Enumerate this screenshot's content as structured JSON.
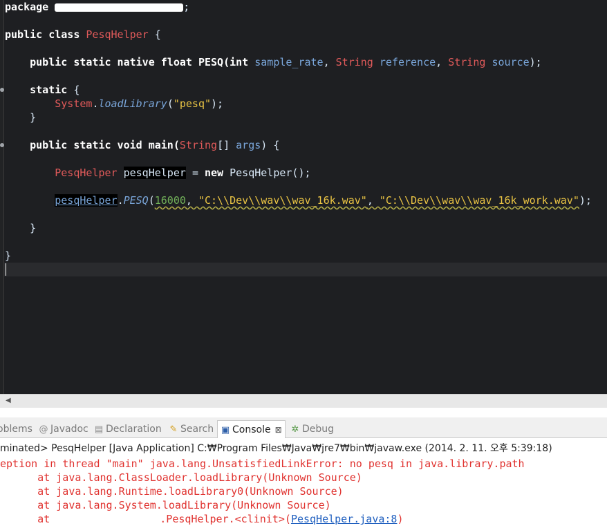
{
  "editor": {
    "package_keyword": "package",
    "package_tail": ";",
    "class_keywords": "public class",
    "class_name": "PesqHelper",
    "open_brace": "{",
    "native_kw": "public static native float",
    "native_method": "PESQ(",
    "int_kw": "int",
    "param1": "sample_rate",
    "comma1": ",",
    "string_type1": "String",
    "param2": "reference",
    "comma2": ",",
    "string_type2": "String",
    "param3": "source",
    "native_end": ");",
    "static_kw": "static",
    "static_open": "{",
    "system_cls": "System",
    "dot1": ".",
    "load_method": "loadLibrary",
    "load_open": "(",
    "load_arg": "\"pesq\"",
    "load_close": ");",
    "static_close": "}",
    "main_kw": "public static void",
    "main_name": "main(",
    "main_string": "String",
    "main_brackets": "[]",
    "main_args": "args",
    "main_end": ") {",
    "var_type": "PesqHelper",
    "var_name": "pesqHelper",
    "assign": "=",
    "new_kw": "new",
    "ctor_call": "PesqHelper();",
    "call_var": "pesqHelper",
    "call_dot": ".",
    "call_method": "PESQ",
    "call_open": "(",
    "call_num": "16000",
    "call_sep1": ",",
    "call_str1": "\"C:\\\\Dev\\\\wav\\\\wav_16k.wav\"",
    "call_sep2": ",",
    "call_str2": "\"C:\\\\Dev\\\\wav\\\\wav_16k_work.wav\"",
    "call_close": ");",
    "main_close": "}",
    "class_close": "}"
  },
  "tabs": [
    {
      "label": "oblems",
      "icon": "problems-icon",
      "active": false
    },
    {
      "label": "Javadoc",
      "icon": "javadoc-icon",
      "icon_glyph": "@",
      "active": false
    },
    {
      "label": "Declaration",
      "icon": "declaration-icon",
      "active": false
    },
    {
      "label": "Search",
      "icon": "search-icon",
      "active": false
    },
    {
      "label": "Console",
      "icon": "console-icon",
      "active": true,
      "close": "⊠"
    },
    {
      "label": "Debug",
      "icon": "debug-icon",
      "active": false
    }
  ],
  "console": {
    "header": "minated> PesqHelper [Java Application] C:₩Program Files₩Java₩jre7₩bin₩javaw.exe (2014. 2. 11. 오후 5:39:18)",
    "lines": [
      "eption in thread \"main\" java.lang.UnsatisfiedLinkError: no pesq in java.library.path",
      "      at java.lang.ClassLoader.loadLibrary(Unknown Source)",
      "      at java.lang.Runtime.loadLibrary0(Unknown Source)",
      "      at java.lang.System.loadLibrary(Unknown Source)"
    ],
    "last_prefix": "      at ",
    "last_mid": ".PesqHelper.<clinit>(",
    "last_link": "PesqHelper.java:8",
    "last_suffix": ")"
  },
  "colors": {
    "editor_bg": "#1e1f22",
    "keyword": "#ffffff",
    "type": "#e05a5a",
    "param": "#7aa6da",
    "string": "#eac444",
    "number": "#73b35a",
    "error": "#e0322f",
    "link": "#1f5fbf"
  }
}
